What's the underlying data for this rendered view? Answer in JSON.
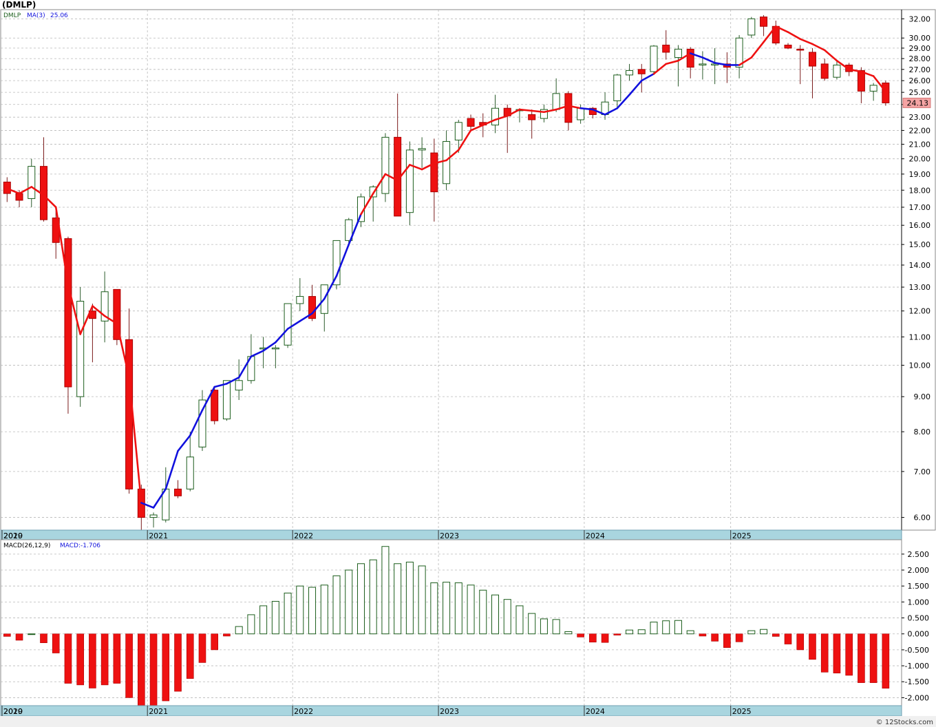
{
  "title": "(DMLP)",
  "watermark": "© 12Stocks.com",
  "colors": {
    "up_candle_border": "#1a5c1a",
    "down_candle": "#ee1111",
    "ma_up": "#1111dd",
    "ma_down": "#ee1111",
    "grid": "#b8b8b8",
    "axis_band": "#a9d5df",
    "hist_up": "#1a5c1a",
    "hist_down": "#ee1111",
    "legend_ma": "#1111dd",
    "price_tag_bg": "#f4a3a3"
  },
  "chart_data": [
    {
      "type": "candlestick",
      "scale": "log",
      "ylim": [
        5.75,
        33.0
      ],
      "legend": {
        "symbol": "DMLP",
        "ma_label": "MA(3)",
        "ma_value": "25.06"
      },
      "last_price": "24.13",
      "y_ticks": [
        "6.00",
        "7.00",
        "8.00",
        "9.00",
        "10.00",
        "11.00",
        "12.00",
        "13.00",
        "14.00",
        "15.00",
        "16.00",
        "17.00",
        "18.00",
        "19.00",
        "20.00",
        "21.00",
        "22.00",
        "23.00",
        "24.00",
        "25.00",
        "26.00",
        "27.00",
        "28.00",
        "29.00",
        "30.00",
        "32.00"
      ],
      "x_labels": [
        {
          "label": "2019",
          "idx": -3.55
        },
        {
          "label": "2020",
          "idx": -0.45
        },
        {
          "label": "2021",
          "idx": 11.5
        },
        {
          "label": "2022",
          "idx": 23.4
        },
        {
          "label": "2023",
          "idx": 35.35
        },
        {
          "label": "2024",
          "idx": 47.3
        },
        {
          "label": "2025",
          "idx": 59.3
        }
      ],
      "candles": [
        [
          18.5,
          18.8,
          17.3,
          17.8
        ],
        [
          17.8,
          18.0,
          17.0,
          17.4
        ],
        [
          17.5,
          20.0,
          17.0,
          19.5
        ],
        [
          19.5,
          21.5,
          16.2,
          16.3
        ],
        [
          16.4,
          16.8,
          14.3,
          15.1
        ],
        [
          15.3,
          15.4,
          8.5,
          9.3
        ],
        [
          9.0,
          13.0,
          8.7,
          12.4
        ],
        [
          12.0,
          12.3,
          10.1,
          11.7
        ],
        [
          11.6,
          13.7,
          10.8,
          12.8
        ],
        [
          12.9,
          12.9,
          10.7,
          10.9
        ],
        [
          10.9,
          12.1,
          6.5,
          6.6
        ],
        [
          6.6,
          6.7,
          5.75,
          6.0
        ],
        [
          6.0,
          6.1,
          5.8,
          6.05
        ],
        [
          5.95,
          7.1,
          5.9,
          6.6
        ],
        [
          6.6,
          6.8,
          6.4,
          6.45
        ],
        [
          6.6,
          8.0,
          6.55,
          7.35
        ],
        [
          7.6,
          9.2,
          7.5,
          8.9
        ],
        [
          9.2,
          9.3,
          8.2,
          8.3
        ],
        [
          8.35,
          9.5,
          8.3,
          9.5
        ],
        [
          9.2,
          10.2,
          8.9,
          9.5
        ],
        [
          9.5,
          11.1,
          9.4,
          10.3
        ],
        [
          10.6,
          11.0,
          9.9,
          10.6
        ],
        [
          10.6,
          10.7,
          9.9,
          10.6
        ],
        [
          10.7,
          11.9,
          10.6,
          12.3
        ],
        [
          12.3,
          13.4,
          12.0,
          12.6
        ],
        [
          12.6,
          13.1,
          11.6,
          11.7
        ],
        [
          11.9,
          12.9,
          11.2,
          13.1
        ],
        [
          13.1,
          14.3,
          12.9,
          15.2
        ],
        [
          15.2,
          16.4,
          14.9,
          16.3
        ],
        [
          16.2,
          17.8,
          15.9,
          17.6
        ],
        [
          17.6,
          18.3,
          16.2,
          18.2
        ],
        [
          17.8,
          21.8,
          17.3,
          21.5
        ],
        [
          21.5,
          24.9,
          16.5,
          16.5
        ],
        [
          16.7,
          21.2,
          16.0,
          20.6
        ],
        [
          20.6,
          21.5,
          19.4,
          20.7
        ],
        [
          20.4,
          21.4,
          16.2,
          17.9
        ],
        [
          18.4,
          22.0,
          18.0,
          21.2
        ],
        [
          21.3,
          22.8,
          20.4,
          22.6
        ],
        [
          22.9,
          23.2,
          21.9,
          22.3
        ],
        [
          22.6,
          23.3,
          21.5,
          22.4
        ],
        [
          22.4,
          24.8,
          21.8,
          23.7
        ],
        [
          23.7,
          24.0,
          20.4,
          23.1
        ],
        [
          23.5,
          23.7,
          22.6,
          23.6
        ],
        [
          23.2,
          23.6,
          21.4,
          22.8
        ],
        [
          22.9,
          24.0,
          22.6,
          23.6
        ],
        [
          23.6,
          26.2,
          23.4,
          24.9
        ],
        [
          24.9,
          25.1,
          22.0,
          22.6
        ],
        [
          22.8,
          24.0,
          22.5,
          23.7
        ],
        [
          23.7,
          23.8,
          22.9,
          23.2
        ],
        [
          23.2,
          25.0,
          22.8,
          24.2
        ],
        [
          24.3,
          26.6,
          23.8,
          26.5
        ],
        [
          26.5,
          27.5,
          26.0,
          26.9
        ],
        [
          27.0,
          27.5,
          25.0,
          26.6
        ],
        [
          26.8,
          29.3,
          26.5,
          29.2
        ],
        [
          29.3,
          30.8,
          27.9,
          28.6
        ],
        [
          28.1,
          29.3,
          25.5,
          28.9
        ],
        [
          28.9,
          29.1,
          26.2,
          27.2
        ],
        [
          27.4,
          28.7,
          26.1,
          27.5
        ],
        [
          27.4,
          29.0,
          25.7,
          27.5
        ],
        [
          27.5,
          28.6,
          25.8,
          27.2
        ],
        [
          27.2,
          30.3,
          26.2,
          30.0
        ],
        [
          30.3,
          32.2,
          30.0,
          32.0
        ],
        [
          32.2,
          32.4,
          30.2,
          31.2
        ],
        [
          31.2,
          31.8,
          29.3,
          29.5
        ],
        [
          29.3,
          29.5,
          28.9,
          29.0
        ],
        [
          28.9,
          29.3,
          25.7,
          28.8
        ],
        [
          28.6,
          29.0,
          24.5,
          27.3
        ],
        [
          27.5,
          28.0,
          26.0,
          26.2
        ],
        [
          26.3,
          27.9,
          26.1,
          27.4
        ],
        [
          27.4,
          27.6,
          26.4,
          26.8
        ],
        [
          26.9,
          27.2,
          24.1,
          25.1
        ],
        [
          25.1,
          25.8,
          24.3,
          25.6
        ],
        [
          25.8,
          26.0,
          23.9,
          24.13
        ]
      ],
      "ma3": [
        18.1,
        17.8,
        18.2,
        17.7,
        17.0,
        13.1,
        11.1,
        12.2,
        11.8,
        11.5,
        9.6,
        6.3,
        6.2,
        6.6,
        7.5,
        7.9,
        8.6,
        9.3,
        9.4,
        9.6,
        10.3,
        10.5,
        10.8,
        11.3,
        11.6,
        11.9,
        12.5,
        13.5,
        15.0,
        16.6,
        17.8,
        19.0,
        18.6,
        19.6,
        19.3,
        19.7,
        19.9,
        20.6,
        22.0,
        22.4,
        22.8,
        23.1,
        23.6,
        23.5,
        23.4,
        23.6,
        23.9,
        23.7,
        23.6,
        23.2,
        23.7,
        24.8,
        26.0,
        26.6,
        27.5,
        27.8,
        28.5,
        28.1,
        27.6,
        27.4,
        27.4,
        28.1,
        29.6,
        31.2,
        30.6,
        29.9,
        29.4,
        28.8,
        27.8,
        27.0,
        26.8,
        26.4,
        25.06
      ],
      "ma3_up_segments": [
        [
          11,
          29
        ],
        [
          47,
          53
        ],
        [
          56,
          60
        ]
      ]
    },
    {
      "type": "bar",
      "legend": {
        "name": "MACD(26,12,9)",
        "value_label": "MACD:-1.706"
      },
      "ylim": [
        -2.25,
        2.95
      ],
      "y_ticks": [
        "-2.000",
        "-1.500",
        "-1.000",
        "-0.500",
        "0.000",
        "0.500",
        "1.000",
        "1.500",
        "2.000",
        "2.500"
      ],
      "values": [
        -0.08,
        -0.2,
        0.0,
        -0.28,
        -0.6,
        -1.55,
        -1.6,
        -1.7,
        -1.6,
        -1.55,
        -2.0,
        -2.3,
        -2.3,
        -2.1,
        -1.8,
        -1.4,
        -0.9,
        -0.5,
        -0.07,
        0.23,
        0.6,
        0.88,
        1.02,
        1.28,
        1.5,
        1.46,
        1.53,
        1.82,
        2.0,
        2.2,
        2.32,
        2.74,
        2.2,
        2.25,
        2.13,
        1.6,
        1.62,
        1.6,
        1.53,
        1.37,
        1.22,
        1.08,
        0.88,
        0.64,
        0.47,
        0.45,
        0.07,
        -0.1,
        -0.26,
        -0.27,
        -0.04,
        0.12,
        0.13,
        0.37,
        0.41,
        0.42,
        0.1,
        -0.07,
        -0.23,
        -0.43,
        -0.25,
        0.1,
        0.14,
        -0.08,
        -0.32,
        -0.5,
        -0.8,
        -1.2,
        -1.23,
        -1.3,
        -1.53,
        -1.53,
        -1.706
      ]
    }
  ]
}
